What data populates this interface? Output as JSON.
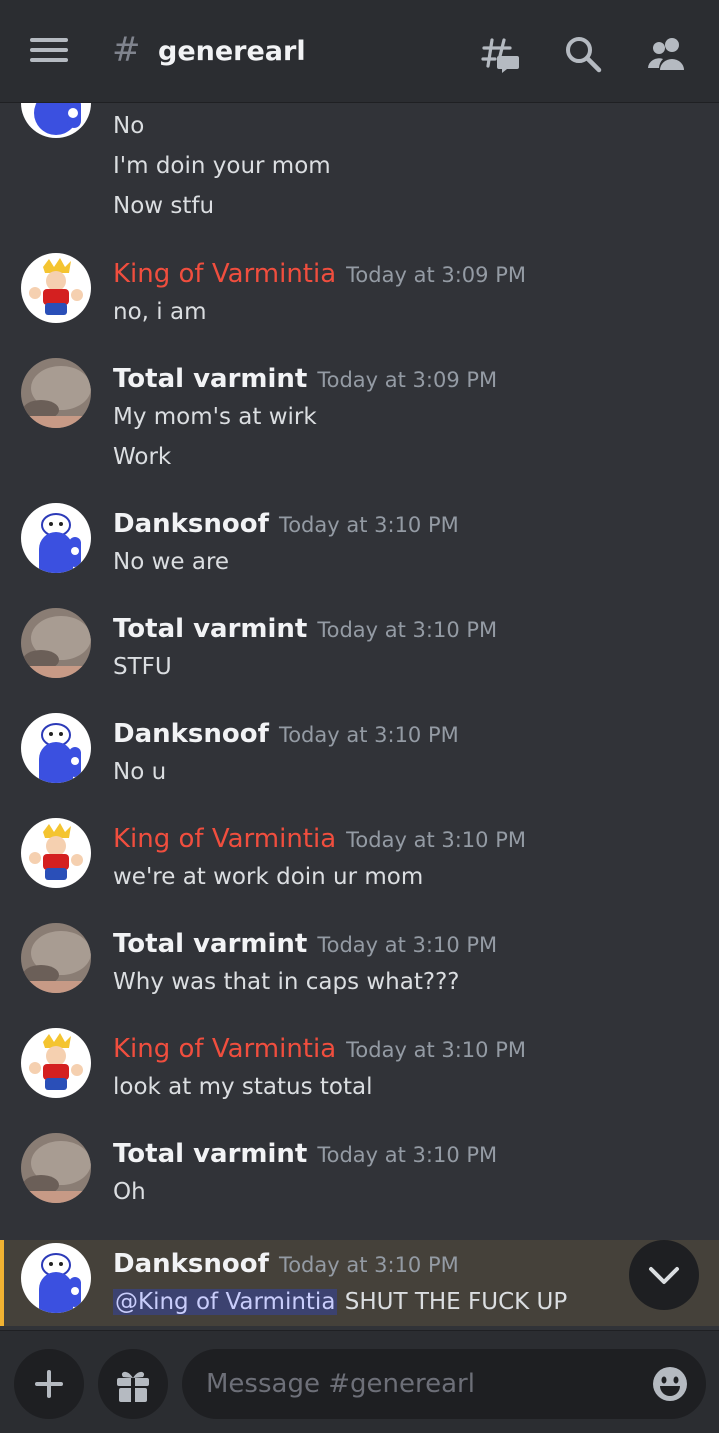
{
  "header": {
    "channel_hash": "#",
    "channel_name": "generearl",
    "icons": [
      "menu-icon",
      "threads-icon",
      "search-icon",
      "members-icon"
    ]
  },
  "messages": [
    {
      "author": "",
      "time": "",
      "lines": [
        "No",
        "I'm doin your mom",
        "Now stfu"
      ],
      "avatar": "danksnoof"
    },
    {
      "author": "King of Varmintia",
      "time": "Today at 3:09 PM",
      "lines": [
        "no, i am"
      ],
      "avatar": "king",
      "color": "#f04e3e"
    },
    {
      "author": "Total varmint",
      "time": "Today at 3:09 PM",
      "lines": [
        "My mom's at wirk",
        "Work"
      ],
      "avatar": "cat"
    },
    {
      "author": "Danksnoof",
      "time": "Today at 3:10 PM",
      "lines": [
        "No we are"
      ],
      "avatar": "danksnoof"
    },
    {
      "author": "Total varmint",
      "time": "Today at 3:10 PM",
      "lines": [
        "STFU"
      ],
      "avatar": "cat"
    },
    {
      "author": "Danksnoof",
      "time": "Today at 3:10 PM",
      "lines": [
        "No u"
      ],
      "avatar": "danksnoof"
    },
    {
      "author": "King of Varmintia",
      "time": "Today at 3:10 PM",
      "lines": [
        "we're at work doin ur mom"
      ],
      "avatar": "king",
      "color": "#f04e3e"
    },
    {
      "author": "Total varmint",
      "time": "Today at 3:10 PM",
      "lines": [
        "Why was that in caps what???"
      ],
      "avatar": "cat"
    },
    {
      "author": "King of Varmintia",
      "time": "Today at 3:10 PM",
      "lines": [
        "look at my status total"
      ],
      "avatar": "king",
      "color": "#f04e3e"
    },
    {
      "author": "Total varmint",
      "time": "Today at 3:10 PM",
      "lines": [
        "Oh"
      ],
      "avatar": "cat"
    },
    {
      "author": "Danksnoof",
      "time": "Today at 3:10 PM",
      "mention": "@King of Varmintia",
      "lines": [
        "SHUT THE FUCK UP"
      ],
      "avatar": "danksnoof",
      "highlighted": true
    }
  ],
  "composer": {
    "placeholder": "Message #generearl"
  },
  "colors": {
    "background": "#313338",
    "header": "#2b2d31",
    "mention_highlight": "#45413a",
    "mention_bar": "#f0b232",
    "role_red": "#f04e3e"
  }
}
